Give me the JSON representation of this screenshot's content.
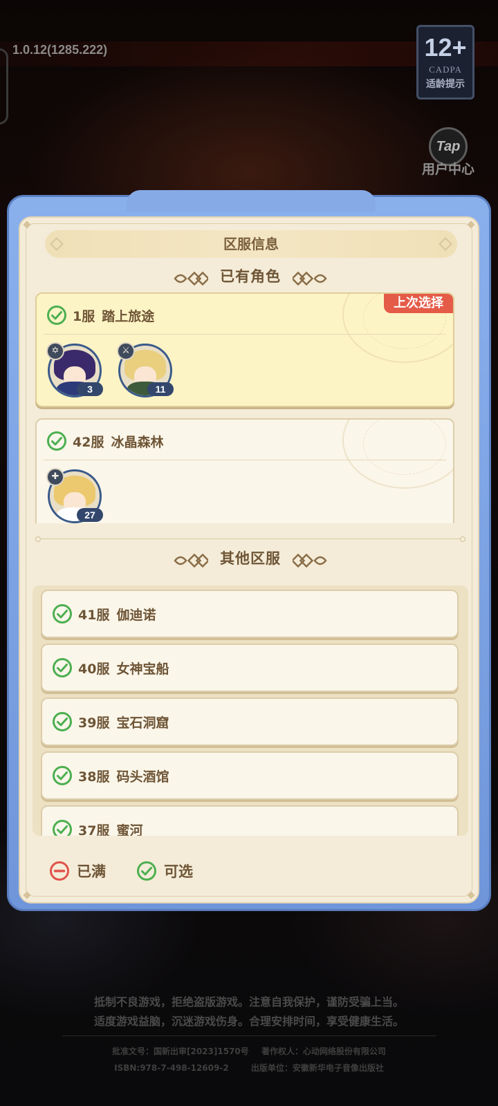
{
  "app": {
    "version": "1.0.12(1285.222)",
    "age_rating": {
      "age": "12+",
      "org": "CADPA",
      "hint": "适龄提示"
    },
    "user_center": {
      "icon": "Tap",
      "label": "用户中心"
    }
  },
  "dialog": {
    "title": "区服信息",
    "owned_section_title": "已有角色",
    "others_section_title": "其他区服",
    "owned_servers": [
      {
        "number": "1服",
        "name": "踏上旅途",
        "badge": "上次选择",
        "characters": [
          {
            "class_icon": "star-class-icon",
            "level": "3"
          },
          {
            "class_icon": "sword-class-icon",
            "level": "11"
          }
        ]
      },
      {
        "number": "42服",
        "name": "冰晶森林",
        "characters": [
          {
            "class_icon": "cross-class-icon",
            "level": "27"
          }
        ]
      }
    ],
    "other_servers": [
      {
        "number": "41服",
        "name": "伽迪诺"
      },
      {
        "number": "40服",
        "name": "女神宝船"
      },
      {
        "number": "39服",
        "name": "宝石洞窟"
      },
      {
        "number": "38服",
        "name": "码头酒馆"
      },
      {
        "number": "37服",
        "name": "蜜河"
      }
    ],
    "legend": {
      "full": "已满",
      "available": "可选"
    }
  },
  "footer": {
    "warning_line1": "抵制不良游戏，拒绝盗版游戏。注意自我保护，谨防受骗上当。",
    "warning_line2": "适度游戏益脑，沉迷游戏伤身。合理安排时间，享受健康生活。",
    "approval": "批准文号：国新出审[2023]1570号",
    "copyright": "著作权人：心动网络股份有限公司",
    "isbn": "ISBN:978-7-498-12609-2",
    "publisher": "出版单位：安徽新华电子音像出版社"
  },
  "colors": {
    "modal_blue": "#7ea4e4",
    "panel_cream": "#f4ecd8",
    "available_green": "#4caf50",
    "full_red": "#e0524a",
    "badge_red": "#e45b48"
  }
}
